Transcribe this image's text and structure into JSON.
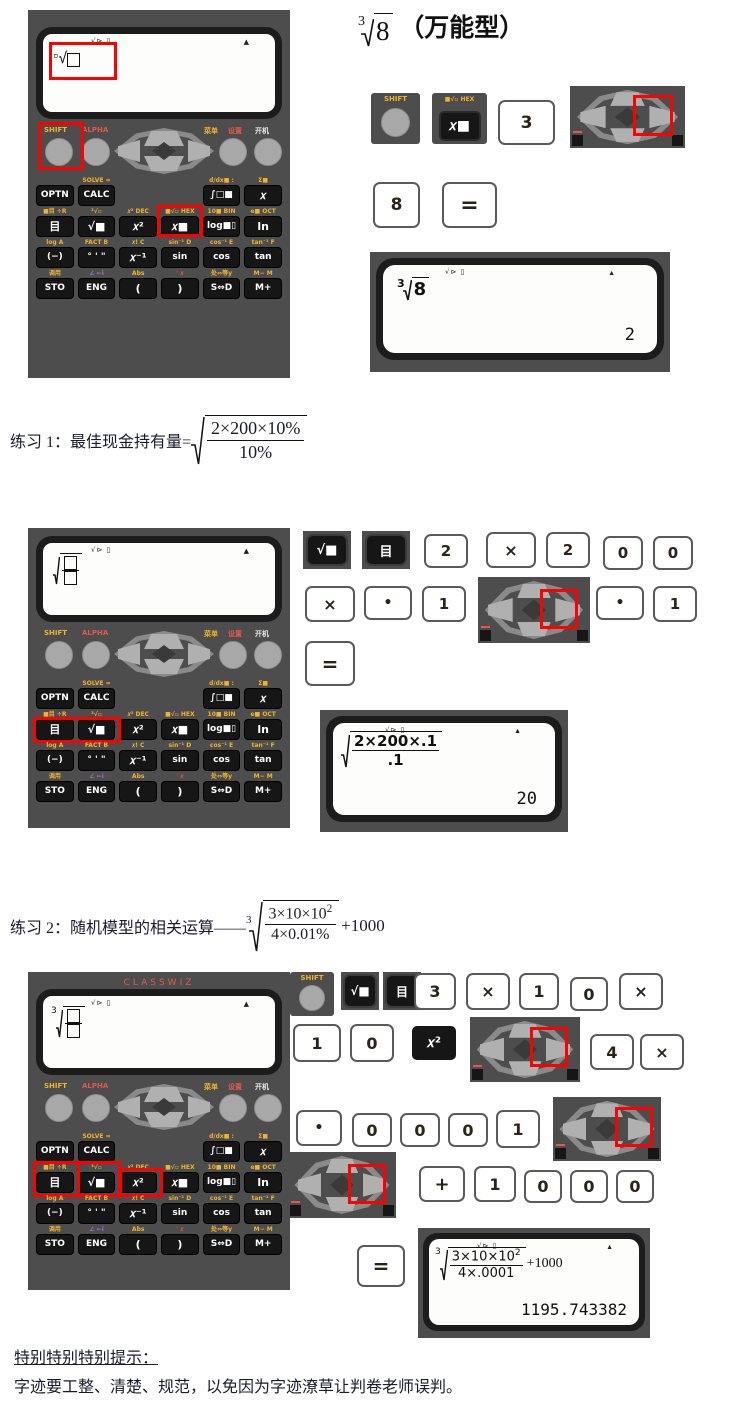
{
  "doc": {
    "title_expr_root_index": "3",
    "title_expr_radicand": "8",
    "title_suffix": "（万能型）",
    "exercise1_label": "练习 1：最佳现金持有量=",
    "exercise1_num": "2×200×10%",
    "exercise1_den": "10%",
    "exercise2_label": "练习 2：随机模型的相关运算——",
    "exercise2_root_index": "3",
    "exercise2_num": "3×10×10",
    "exercise2_num_exp": "2",
    "exercise2_den": "4×0.01%",
    "exercise2_tail": "+1000",
    "tip_heading": "特别特别特别提示：",
    "tip_body": "字迹要工整、清楚、规范，以免因为字迹潦草让判卷老师误判。"
  },
  "calculator": {
    "brand": "CLASSWIZ",
    "status_icons": "√⊳ ▯",
    "battery_triangle": "▲",
    "round_keys": [
      {
        "label": "SHIFT",
        "color": "#f0b429"
      },
      {
        "label": "ALPHA",
        "color": "#e2584d"
      },
      {
        "label": "菜单",
        "color": "#f0b429"
      },
      {
        "label": "设置",
        "color": "#e2584d"
      },
      {
        "label": "开机",
        "color": "#ffffff"
      }
    ],
    "rows": [
      {
        "keys": [
          {
            "top": "",
            "top_color": "",
            "label": "OPTN",
            "size": "sm"
          },
          {
            "top": "SOLVE =",
            "top_color": "#f0b429",
            "label": "CALC",
            "size": "sm"
          },
          {
            "top": "",
            "top_color": "",
            "label": "",
            "size": "sm"
          },
          {
            "top": "",
            "top_color": "",
            "label": "",
            "size": "sm"
          },
          {
            "top": "d/dx■  :",
            "top_color": "#f0b429",
            "label": "∫□■",
            "size": "sm"
          },
          {
            "top": "Σ■",
            "top_color": "#f0b429",
            "label": "𝑥",
            "size": ""
          }
        ]
      },
      {
        "keys": [
          {
            "top": "■目  ÷R",
            "top_color": "#f0b429",
            "label": "目",
            "size": ""
          },
          {
            "top": "³√▫",
            "top_color": "#f0b429",
            "label": "√■",
            "size": ""
          },
          {
            "top": "𝑥³  DEC",
            "top_color": "#f0b429",
            "label": "𝑥²",
            "size": ""
          },
          {
            "top": "■√▫  HEX",
            "top_color": "#f0b429",
            "label": "𝑥■",
            "size": ""
          },
          {
            "top": "10■  BIN",
            "top_color": "#f0b429",
            "label": "log■▯",
            "size": "sm"
          },
          {
            "top": "e■  OCT",
            "top_color": "#f0b429",
            "label": "ln",
            "size": ""
          }
        ]
      },
      {
        "keys": [
          {
            "top": "log  A",
            "top_color": "#f0b429",
            "label": "(−)",
            "size": "sm"
          },
          {
            "top": "FACT B",
            "top_color": "#f0b429",
            "label": "° ' \"",
            "size": "sm"
          },
          {
            "top": "𝑥!  C",
            "top_color": "#f0b429",
            "label": "𝑥⁻¹",
            "size": ""
          },
          {
            "top": "sin⁻¹ D",
            "top_color": "#f0b429",
            "label": "sin",
            "size": "sm"
          },
          {
            "top": "cos⁻¹ E",
            "top_color": "#f0b429",
            "label": "cos",
            "size": "sm"
          },
          {
            "top": "tan⁻¹ F",
            "top_color": "#f0b429",
            "label": "tan",
            "size": "sm"
          }
        ]
      },
      {
        "keys": [
          {
            "top": "调用",
            "top_color": "#f0b429",
            "label": "STO",
            "size": "sm"
          },
          {
            "top": "∠  ←i",
            "top_color": "#9b6fd4",
            "label": "ENG",
            "size": "sm"
          },
          {
            "top": "Abs",
            "top_color": "#f0b429",
            "label": "(",
            "size": ""
          },
          {
            "top": "'    𝑥",
            "top_color": "#e2584d",
            "label": ")",
            "size": ""
          },
          {
            "top": "处⇔等y",
            "top_color": "#f0b429",
            "label": "S⇔D",
            "size": "sm"
          },
          {
            "top": "M−  M",
            "top_color": "#f0b429",
            "label": "M+",
            "size": "sm"
          }
        ]
      }
    ]
  },
  "section1": {
    "screen_expr": "ⁿ√□",
    "highlight_targets": [
      "screen-root-template",
      "shift-key",
      "x-power-key"
    ],
    "keys": [
      {
        "type": "round",
        "label": "SHIFT"
      },
      {
        "type": "dark",
        "label": "𝑥■",
        "sub": "■√▫ HEX",
        "sub_color": "#f0b429"
      },
      {
        "type": "light",
        "label": "3"
      },
      {
        "type": "dpad",
        "label": "right-arrow"
      },
      {
        "type": "light",
        "label": "8"
      },
      {
        "type": "light",
        "label": "="
      }
    ],
    "result_screen": {
      "root_index": "3",
      "radicand": "8",
      "result": "2"
    }
  },
  "section2": {
    "screen_expr": "√(□/□)",
    "keys": [
      {
        "type": "dark",
        "label": "√■"
      },
      {
        "type": "dark",
        "label": "目"
      },
      {
        "type": "light",
        "label": "2"
      },
      {
        "type": "light",
        "label": "×"
      },
      {
        "type": "light",
        "label": "2"
      },
      {
        "type": "light",
        "label": "0"
      },
      {
        "type": "light",
        "label": "0"
      },
      {
        "type": "light",
        "label": "×"
      },
      {
        "type": "light",
        "label": "•"
      },
      {
        "type": "light",
        "label": "1"
      },
      {
        "type": "dpad",
        "label": "right-arrow"
      },
      {
        "type": "light",
        "label": "•"
      },
      {
        "type": "light",
        "label": "1"
      },
      {
        "type": "light",
        "label": "="
      }
    ],
    "result_screen": {
      "num": "2×200×.1",
      "den": ".1",
      "result": "20"
    }
  },
  "section3": {
    "screen_expr": "³√(□/□)",
    "screen_root_index": "3",
    "keys": [
      {
        "type": "round",
        "label": "SHIFT"
      },
      {
        "type": "dark",
        "label": "√■"
      },
      {
        "type": "dark",
        "label": "目"
      },
      {
        "type": "light",
        "label": "3"
      },
      {
        "type": "light",
        "label": "×"
      },
      {
        "type": "light",
        "label": "1"
      },
      {
        "type": "light",
        "label": "0"
      },
      {
        "type": "light",
        "label": "×"
      },
      {
        "type": "light",
        "label": "1"
      },
      {
        "type": "light",
        "label": "0"
      },
      {
        "type": "dark",
        "label": "𝑥²"
      },
      {
        "type": "dpad",
        "label": "right-arrow"
      },
      {
        "type": "light",
        "label": "4"
      },
      {
        "type": "light",
        "label": "×"
      },
      {
        "type": "light",
        "label": "•"
      },
      {
        "type": "light",
        "label": "0"
      },
      {
        "type": "light",
        "label": "0"
      },
      {
        "type": "light",
        "label": "0"
      },
      {
        "type": "light",
        "label": "1"
      },
      {
        "type": "dpad",
        "label": "right-arrow"
      },
      {
        "type": "dpad",
        "label": "right-arrow"
      },
      {
        "type": "light",
        "label": "+"
      },
      {
        "type": "light",
        "label": "1"
      },
      {
        "type": "light",
        "label": "0"
      },
      {
        "type": "light",
        "label": "0"
      },
      {
        "type": "light",
        "label": "0"
      },
      {
        "type": "light",
        "label": "="
      }
    ],
    "result_screen": {
      "root_index": "3",
      "num": "3×10×10",
      "num_exp": "2",
      "den": "4×.0001",
      "tail": "+1000",
      "result": "1195.743382"
    }
  }
}
